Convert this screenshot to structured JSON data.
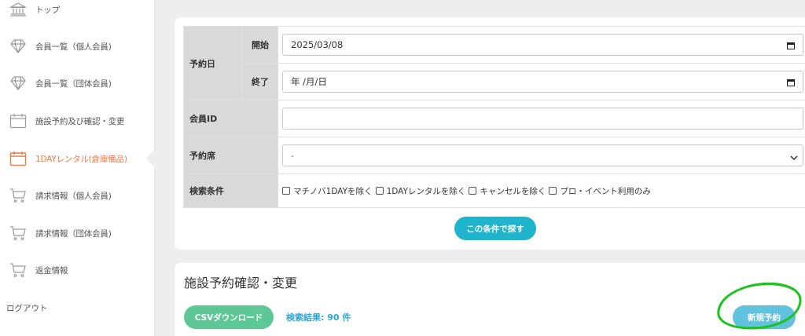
{
  "sidebar": {
    "items": [
      {
        "label": "トップ",
        "icon": "bank-icon"
      },
      {
        "label": "会員一覧（個人会員)",
        "icon": "diamond-icon"
      },
      {
        "label": "会員一覧（団体会員)",
        "icon": "diamond-icon"
      },
      {
        "label": "施設予約及び確認・変更",
        "icon": "calendar-icon"
      },
      {
        "label": "1DAYレンタル(倉庫備品)",
        "icon": "calendar-icon",
        "active": true
      },
      {
        "label": "請求情報（個人会員)",
        "icon": "cart-icon"
      },
      {
        "label": "請求情報（団体会員)",
        "icon": "cart-icon"
      },
      {
        "label": "返金情報",
        "icon": "cart-icon"
      }
    ],
    "logout_label": "ログアウト"
  },
  "search": {
    "reservation_date_label": "予約日",
    "start_label": "開始",
    "start_value": "2025/03/08",
    "end_label": "終了",
    "end_value": "年 /月/日",
    "member_id_label": "会員ID",
    "member_id_value": "",
    "seat_label": "予約席",
    "seat_value": "-",
    "conditions_label": "検索条件",
    "checkboxes": [
      "マチノバ1DAYを除く",
      "1DAYレンタルを除く",
      "キャンセルを除く",
      "プロ・イベント利用のみ"
    ],
    "search_button": "この条件で探す"
  },
  "results": {
    "title": "施設予約確認・変更",
    "csv_button": "CSVダウンロード",
    "count_text": "検索結果: 90 件",
    "new_button": "新規予約"
  },
  "colors": {
    "accent": "#1fb3cc",
    "active_nav": "#f07a4a",
    "csv": "#5dc896",
    "new_button": "#61c2e0",
    "count_text": "#2ba6d8",
    "annotation": "#1ec21e"
  }
}
